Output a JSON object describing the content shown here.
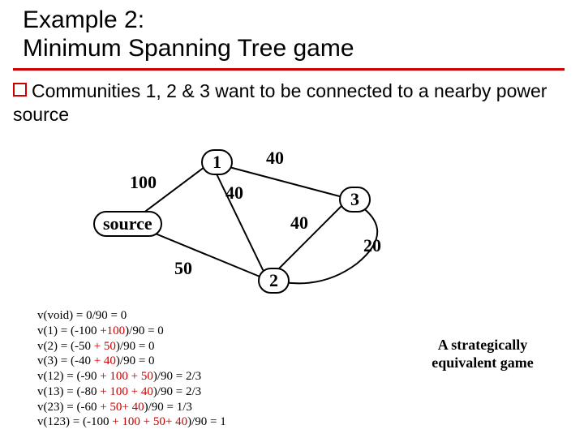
{
  "title_line1": "Example 2:",
  "title_line2": "Minimum Spanning Tree game",
  "bullet_text": "Communities 1, 2 & 3 want to be connected to a nearby power source",
  "graph": {
    "nodes": {
      "source": "source",
      "n1": "1",
      "n2": "2",
      "n3": "3"
    },
    "weights": {
      "w_source_1": "100",
      "w_1_3": "40",
      "w_1_2_upper": "40",
      "w_2_3": "40",
      "w_3_side": "20",
      "w_source_2": "50"
    }
  },
  "vlines": {
    "l0": "v(void) = 0/90 = 0",
    "l1a": "v(1) = (-100 ",
    "l1b": "+100",
    "l1c": ")/90 = 0",
    "l2a": "v(2) = (-50 ",
    "l2b": "+ 50",
    "l2c": ")/90 = 0",
    "l3a": "v(3) = (-40 ",
    "l3b": "+ 40",
    "l3c": ")/90 = 0",
    "l4a": "v(12) = (-90 ",
    "l4b": "+ 100 + 50",
    "l4c": ")/90 = 2/3",
    "l5a": "v(13) = (-80 ",
    "l5b": "+ 100 + 40",
    "l5c": ")/90 = 2/3",
    "l6a": "v(23) = (-60 ",
    "l6b": "+ 50+ 40",
    "l6c": ")/90 = 1/3",
    "l7a": "v(123) = (-100 ",
    "l7b": "+ 100 + 50+ 40",
    "l7c": ")/90 = 1"
  },
  "caption_line1": "A strategically",
  "caption_line2": "equivalent game"
}
